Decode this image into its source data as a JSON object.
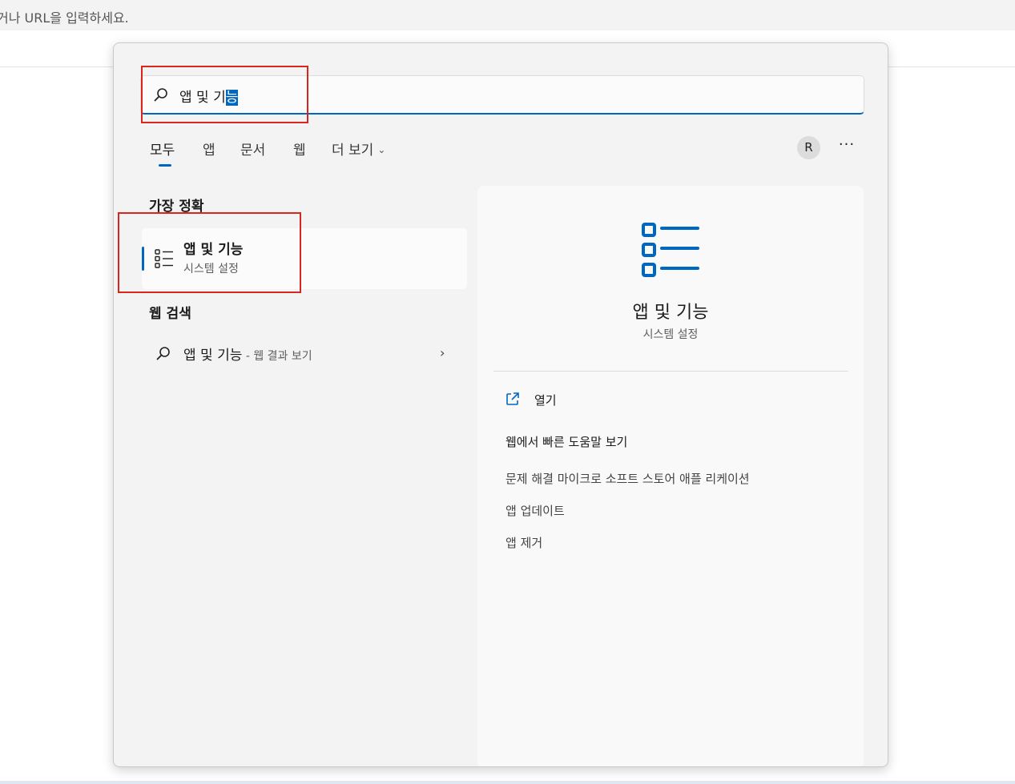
{
  "browser": {
    "address_placeholder": "거나 URL을 입력하세요."
  },
  "search": {
    "query_prefix": "앱 및 기",
    "query_selected": "능",
    "icon": "search-icon"
  },
  "tabs": [
    {
      "label": "모두",
      "active": true
    },
    {
      "label": "앱"
    },
    {
      "label": "문서"
    },
    {
      "label": "웹"
    },
    {
      "label": "더 보기"
    }
  ],
  "header": {
    "avatar_letter": "R",
    "more_label": "···"
  },
  "best_match": {
    "section_title": "가장 정확",
    "title": "앱 및 기능",
    "subtitle": "시스템 설정",
    "icon": "list-icon"
  },
  "web_search": {
    "section_title": "웹 검색",
    "query": "앱 및 기능",
    "suffix": " - 웹 결과 보기"
  },
  "detail": {
    "title": "앱 및 기능",
    "subtitle": "시스템 설정",
    "open_label": "열기",
    "quick_help_title": "웹에서 빠른 도움말 보기",
    "links": [
      "문제 해결 마이크로 소프트 스토어 애플 리케이션",
      "앱 업데이트",
      "앱 제거"
    ]
  },
  "colors": {
    "accent": "#0067c0",
    "highlight_box": "#d9261c"
  }
}
